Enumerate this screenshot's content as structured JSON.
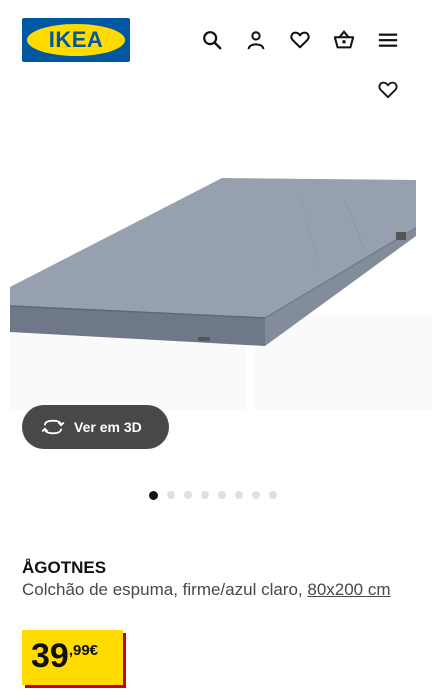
{
  "header": {
    "logo_text": "IKEA",
    "icons": [
      "search-icon",
      "user-icon",
      "heart-icon",
      "basket-icon",
      "menu-icon"
    ]
  },
  "product": {
    "name": "ÅGOTNES",
    "description_prefix": "Colchão de espuma, firme/azul claro, ",
    "size_link": "80x200 cm",
    "price_integer": "39",
    "price_decimal": ",99€"
  },
  "view_3d": {
    "label": "Ver em 3D"
  },
  "gallery": {
    "image_count": 8,
    "active_index": 0
  },
  "colors": {
    "ikea_blue": "#0058a3",
    "ikea_yellow": "#ffdb00",
    "price_shadow": "#cc0008",
    "button_dark": "#484848",
    "mattress": "#8e97a6"
  }
}
